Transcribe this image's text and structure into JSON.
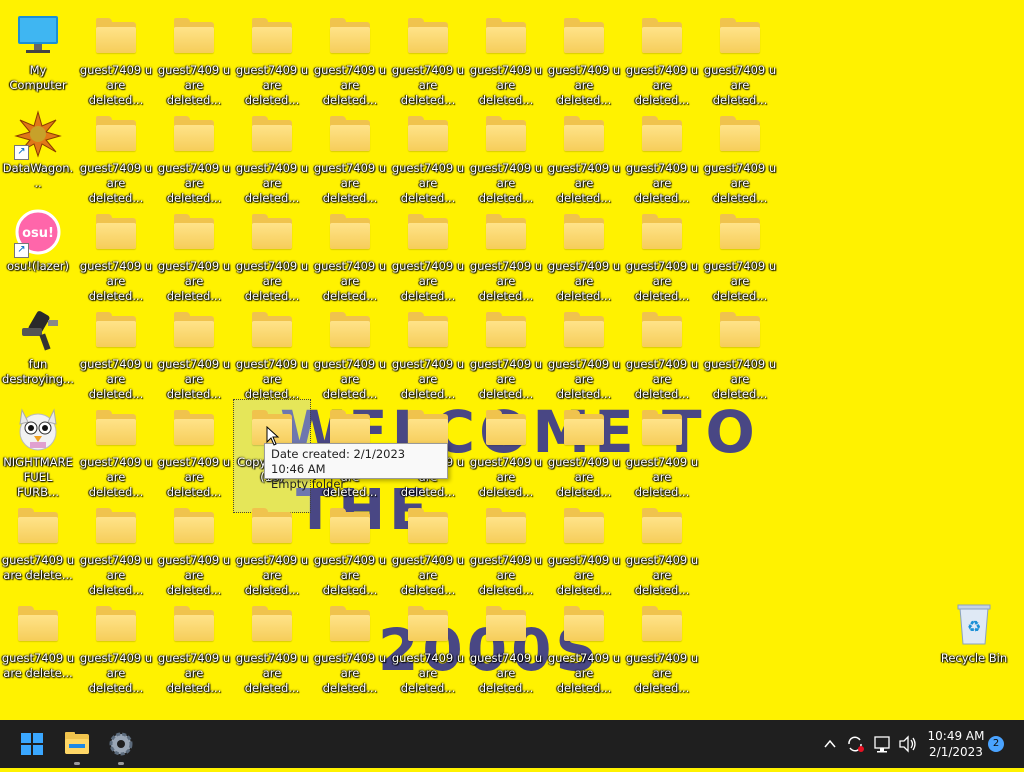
{
  "colors": {
    "wallpaper": "#fff200",
    "taskbar": "#1f1f1f",
    "wallpaper_text": "#2a2a9c",
    "folder": "#f6cd5a"
  },
  "wallpaper": {
    "line1": "WELCOME TO",
    "line2": "THE",
    "line3": "2000S"
  },
  "desktop": {
    "special_icons": [
      {
        "label": "My Computer",
        "icon": "monitor-icon"
      },
      {
        "label": "DataWagon...",
        "icon": "datawagon-icon"
      },
      {
        "label": "osu!(lazer)",
        "icon": "osu-icon"
      },
      {
        "label": "fun destroying...",
        "icon": "fun-destroying-icon"
      },
      {
        "label": "NIGHTMARE FUEL FURB...",
        "icon": "furby-icon"
      }
    ],
    "folder_label": "guest7409 u are deleted...",
    "folder_label_left_column": "guest7409 u are delete...",
    "selected_folder_label": "Copy - Copy (19)",
    "recycle_bin_label": "Recycle Bin"
  },
  "tooltip": {
    "line1": "Date created: 2/1/2023 10:46 AM",
    "line2": "Empty folder"
  },
  "taskbar": {
    "pinned": [
      "start-icon",
      "file-explorer-icon",
      "settings-icon"
    ],
    "tray_icons": [
      "chevron-up-icon",
      "sync-icon",
      "network-icon",
      "volume-icon"
    ],
    "time": "10:49 AM",
    "date": "2/1/2023",
    "notification_count": "2"
  }
}
